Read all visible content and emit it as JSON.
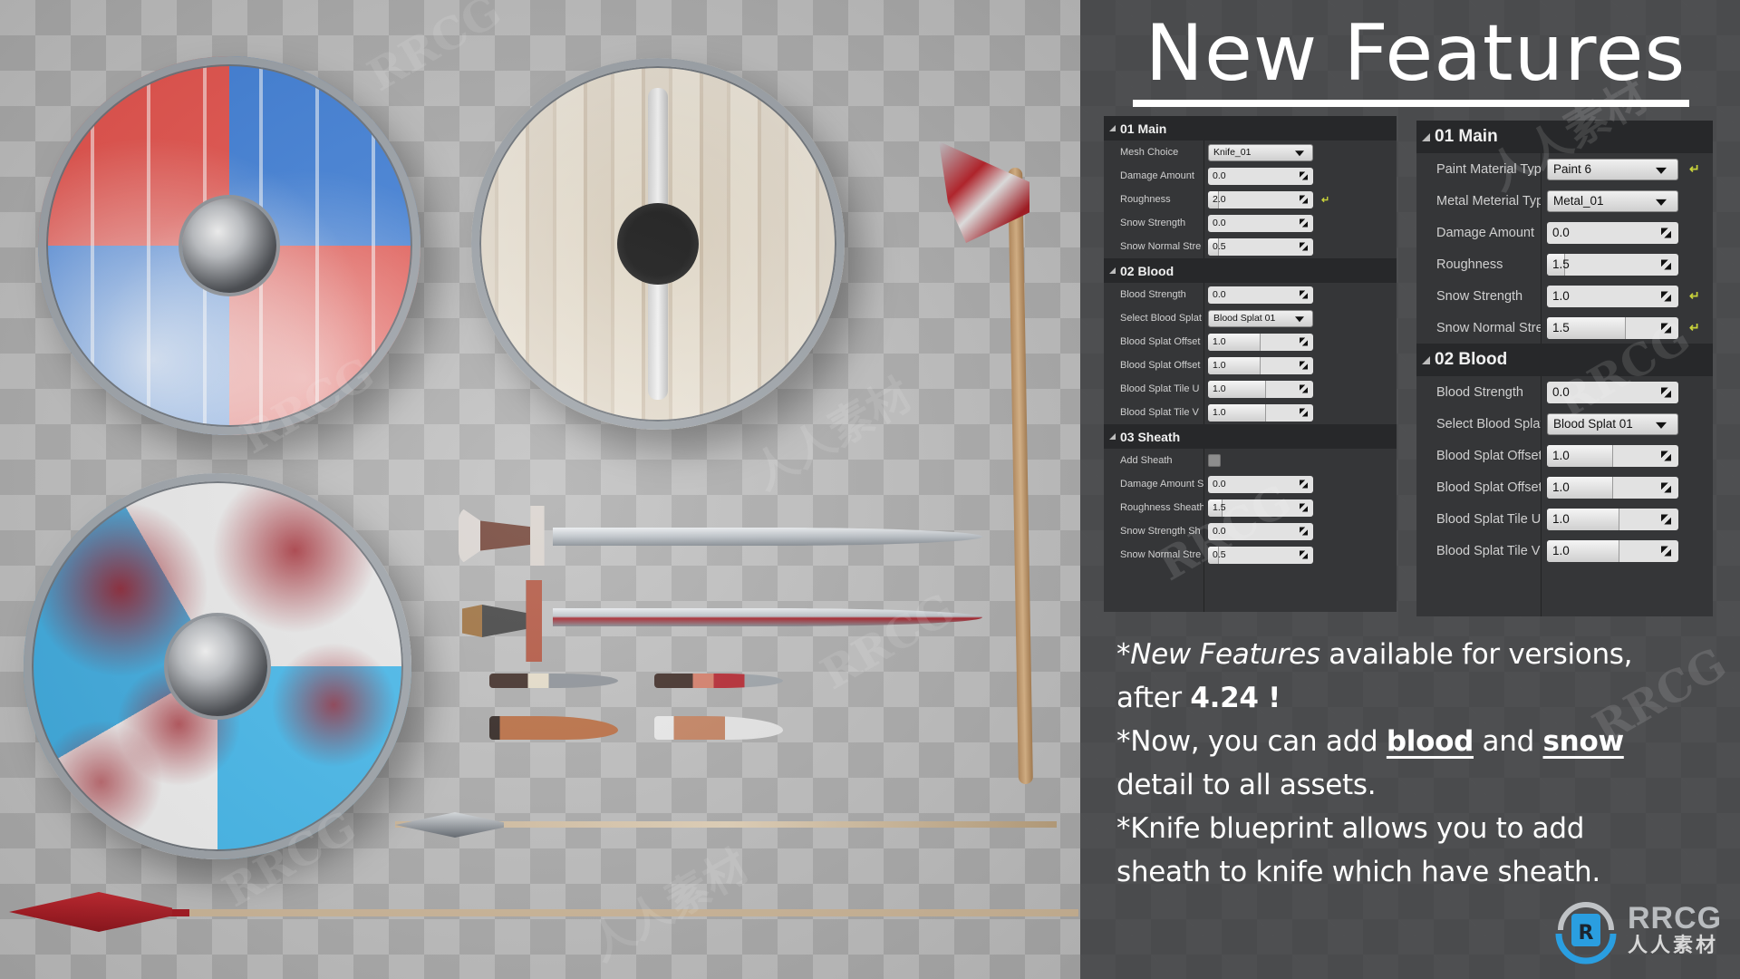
{
  "showcase": {
    "items": [
      "shield-red-blue",
      "shield-wooden",
      "shield-bloody-blue",
      "axe",
      "sword-clean",
      "sword-bloody",
      "knife-clean",
      "knife-bloody",
      "sheath-clean",
      "sheath-snowy",
      "spear-short",
      "spear-long"
    ]
  },
  "info": {
    "title": "New Features",
    "left_panel": {
      "sections": [
        {
          "name": "01 Main",
          "rows": [
            {
              "label": "Mesh Choice",
              "type": "dropdown",
              "value": "Knife_01"
            },
            {
              "label": "Damage Amount",
              "type": "number",
              "value": "0.0",
              "fill": 0.0
            },
            {
              "label": "Roughness",
              "type": "number",
              "value": "2.0",
              "fill": 0.1,
              "reset": true
            },
            {
              "label": "Snow Strength",
              "type": "number",
              "value": "0.0",
              "fill": 0.0
            },
            {
              "label": "Snow Normal Stre",
              "type": "number",
              "value": "0.5",
              "fill": 0.1
            }
          ]
        },
        {
          "name": "02 Blood",
          "rows": [
            {
              "label": "Blood Strength",
              "type": "number",
              "value": "0.0",
              "fill": 0.0
            },
            {
              "label": "Select Blood Splat",
              "type": "dropdown",
              "value": "Blood Splat 01"
            },
            {
              "label": "Blood Splat Offset",
              "type": "number",
              "value": "1.0",
              "fill": 0.5
            },
            {
              "label": "Blood Splat Offset",
              "type": "number",
              "value": "1.0",
              "fill": 0.5
            },
            {
              "label": "Blood Splat Tile U",
              "type": "number",
              "value": "1.0",
              "fill": 0.55
            },
            {
              "label": "Blood Splat Tile V",
              "type": "number",
              "value": "1.0",
              "fill": 0.55
            }
          ]
        },
        {
          "name": "03 Sheath",
          "rows": [
            {
              "label": "Add Sheath",
              "type": "checkbox",
              "checked": false
            },
            {
              "label": "Damage Amount S",
              "type": "number",
              "value": "0.0",
              "fill": 0.0
            },
            {
              "label": "Roughness Sheath",
              "type": "number",
              "value": "1.5",
              "fill": 0.14
            },
            {
              "label": "Snow Strength Sh",
              "type": "number",
              "value": "0.0",
              "fill": 0.0
            },
            {
              "label": "Snow Normal Stre",
              "type": "number",
              "value": "0.5",
              "fill": 0.1
            }
          ]
        }
      ]
    },
    "right_panel": {
      "sections": [
        {
          "name": "01 Main",
          "rows": [
            {
              "label": "Paint Material Typ",
              "type": "dropdown",
              "value": "Paint 6",
              "reset": true
            },
            {
              "label": "Metal Meterial Typ",
              "type": "dropdown",
              "value": "Metal_01"
            },
            {
              "label": "Damage Amount",
              "type": "number",
              "value": "0.0",
              "fill": 0.0
            },
            {
              "label": "Roughness",
              "type": "number",
              "value": "1.5",
              "fill": 0.14
            },
            {
              "label": "Snow Strength",
              "type": "number",
              "value": "1.0",
              "fill": 0.0,
              "reset": true
            },
            {
              "label": "Snow Normal Stre",
              "type": "number",
              "value": "1.5",
              "fill": 0.6,
              "reset": true
            }
          ]
        },
        {
          "name": "02 Blood",
          "rows": [
            {
              "label": "Blood Strength",
              "type": "number",
              "value": "0.0",
              "fill": 0.0
            },
            {
              "label": "Select Blood Splat",
              "type": "dropdown",
              "value": "Blood Splat 01"
            },
            {
              "label": "Blood Splat Offset",
              "type": "number",
              "value": "1.0",
              "fill": 0.5
            },
            {
              "label": "Blood Splat Offset",
              "type": "number",
              "value": "1.0",
              "fill": 0.5
            },
            {
              "label": "Blood Splat Tile U",
              "type": "number",
              "value": "1.0",
              "fill": 0.55
            },
            {
              "label": "Blood Splat Tile V",
              "type": "number",
              "value": "1.0",
              "fill": 0.55
            }
          ]
        }
      ]
    },
    "notes": {
      "line1_star": "*",
      "line1_italic": "New Features",
      "line1_rest": " available for versions,",
      "line2_pre": "after ",
      "line2_bold": "4.24 !",
      "line3_pre": "*Now, you can add ",
      "line3_blood": "blood",
      "line3_mid": " and ",
      "line3_snow": "snow",
      "line4": "detail to all assets.",
      "line5": "*Knife blueprint allows you to add",
      "line6": "sheath to knife which have sheath."
    },
    "logo": {
      "en": "RRCG",
      "cn": "人人素材",
      "colors": {
        "ring": "#2a9ee0",
        "ring_gray": "#c0c3c6"
      }
    },
    "colors": {
      "reset_icon": "#c8d23a",
      "panel_bg": "#353638",
      "header_bg": "#27282a",
      "info_bg": "#4a4b4d"
    }
  },
  "watermarks": [
    "RRCG",
    "人人素材"
  ]
}
